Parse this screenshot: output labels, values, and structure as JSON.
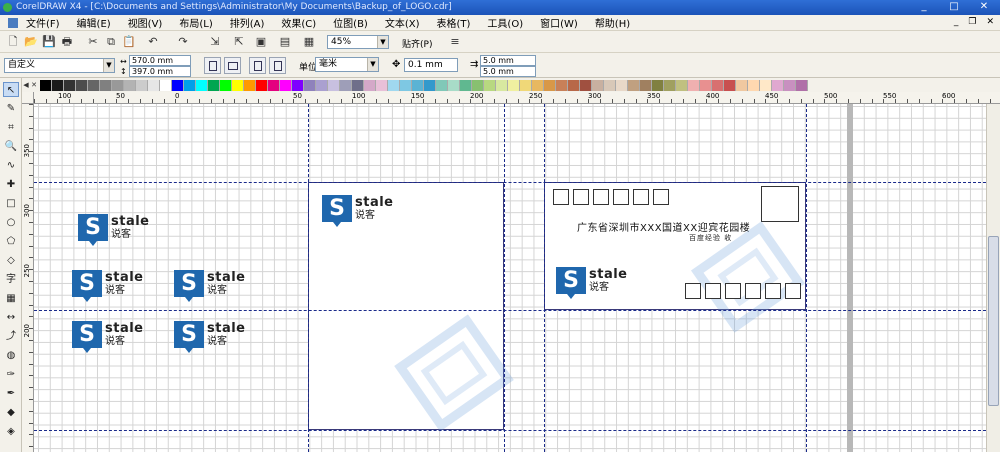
{
  "titlebar": {
    "text": "CorelDRAW X4 - [C:\\Documents and Settings\\Administrator\\My Documents\\Backup_of_LOGO.cdr]",
    "minimize": "_",
    "maximize": "□",
    "close": "✕"
  },
  "menu": [
    "文件(F)",
    "编辑(E)",
    "视图(V)",
    "布局(L)",
    "排列(A)",
    "效果(C)",
    "位图(B)",
    "文本(X)",
    "表格(T)",
    "工具(O)",
    "窗口(W)",
    "帮助(H)"
  ],
  "toolbar": {
    "zoom": "45%",
    "snap": "贴齐(P)"
  },
  "propbar": {
    "preset": "自定义",
    "width": "570.0 mm",
    "height": "397.0 mm",
    "units_label": "单位:",
    "units": "毫米",
    "nudge": "0.1 mm",
    "dup_x": "5.0 mm",
    "dup_y": "5.0 mm"
  },
  "ruler": {
    "h_labels": [
      "100",
      "50",
      "0",
      "50",
      "100",
      "150",
      "200",
      "250",
      "300",
      "350",
      "400",
      "450",
      "500",
      "550",
      "600",
      "650"
    ],
    "v_labels": [
      "350",
      "300",
      "250",
      "200"
    ]
  },
  "palette": [
    "#000000",
    "#1a1a1a",
    "#333333",
    "#4d4d4d",
    "#666666",
    "#808080",
    "#999999",
    "#b3b3b3",
    "#cccccc",
    "#e6e6e6",
    "#ffffff",
    "#0000ff",
    "#00a0e9",
    "#00ffff",
    "#00a651",
    "#00ff00",
    "#ffff00",
    "#ff9900",
    "#ff0000",
    "#e4007f",
    "#ff00ff",
    "#7f00ff",
    "#8f82bc",
    "#aaa0d0",
    "#c8c0e0",
    "#9e9eb8",
    "#6f6f8a",
    "#d4a8c8",
    "#e8c0d8",
    "#a0d8ef",
    "#7ec8e3",
    "#5bb3d4",
    "#3399cc",
    "#80c8b8",
    "#a8dcc8",
    "#60b890",
    "#88c070",
    "#b8d880",
    "#d8e8a0",
    "#f0f0a0",
    "#f0d878",
    "#e8b860",
    "#d89848",
    "#c88058",
    "#b86848",
    "#a05040",
    "#c8b0a0",
    "#d8c8b8",
    "#e8d8c8",
    "#c0a080",
    "#a08060",
    "#808040",
    "#a0a060",
    "#c0c080",
    "#f0b0b0",
    "#e89090",
    "#d87070",
    "#c85050",
    "#f0c8a0",
    "#ffd8b0",
    "#ffe8c8",
    "#e0a8d0",
    "#c890c0",
    "#b070a8"
  ],
  "logo": {
    "mark": "S",
    "brand": "stale",
    "sub": "说客"
  },
  "envelope": {
    "address": "广东省深圳市XXX国道XX迎宾花园楼",
    "recipient": "百度经验 收"
  },
  "tools": [
    "pick-tool",
    "shape-tool",
    "crop-tool",
    "zoom-tool",
    "freehand-tool",
    "smart-fill-tool",
    "rectangle-tool",
    "ellipse-tool",
    "polygon-tool",
    "basic-shapes-tool",
    "text-tool",
    "table-tool",
    "dimension-tool",
    "connector-tool",
    "interactive-tool",
    "eyedropper-tool",
    "outline-tool",
    "fill-tool",
    "interactive-fill-tool"
  ]
}
